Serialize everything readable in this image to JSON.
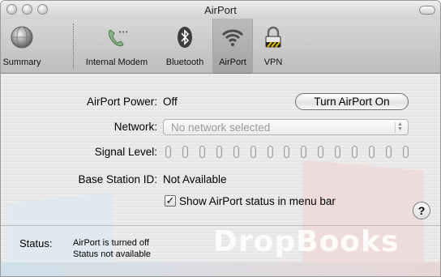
{
  "window": {
    "title": "AirPort"
  },
  "toolbar": {
    "items": [
      {
        "label": "Summary",
        "icon": "globe-icon"
      },
      {
        "label": "Internal Modem",
        "icon": "phone-handset-icon"
      },
      {
        "label": "Bluetooth",
        "icon": "bluetooth-icon"
      },
      {
        "label": "AirPort",
        "icon": "wifi-icon",
        "active": true
      },
      {
        "label": "VPN",
        "icon": "padlock-icon"
      }
    ]
  },
  "airport": {
    "power_label": "AirPort Power:",
    "power_value": "Off",
    "toggle_button": "Turn AirPort On",
    "network_label": "Network:",
    "network_value": "No network selected",
    "signal_label": "Signal Level:",
    "signal_bars_lit": 0,
    "signal_bars_total": 15,
    "base_station_label": "Base Station ID:",
    "base_station_value": "Not Available",
    "show_status_checkbox": "Show AirPort status in menu bar",
    "show_status_checked": true,
    "help_label": "?"
  },
  "status": {
    "label": "Status:",
    "line1": "AirPort is turned off",
    "line2": "Status not available"
  },
  "watermark": {
    "text": "DropBooks"
  },
  "colors": {
    "window_bg": "#ececec",
    "toolbar_bg": "#c9c9c9",
    "disabled_text": "#9a9a9a"
  }
}
